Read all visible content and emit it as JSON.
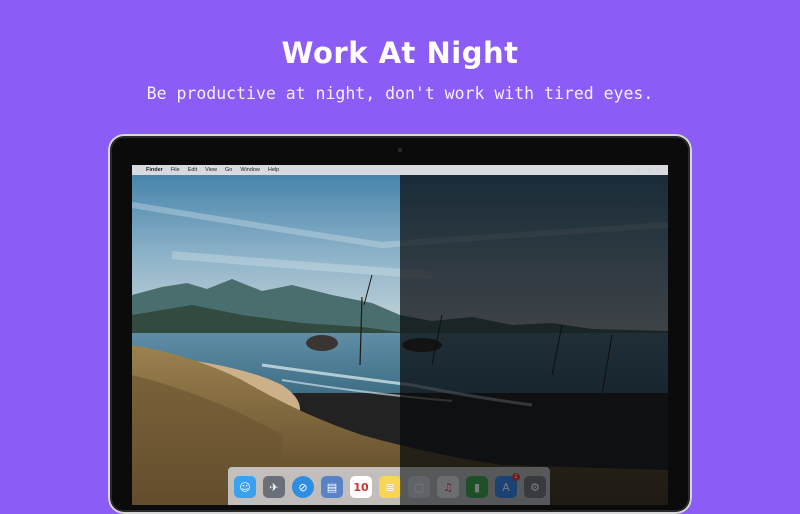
{
  "hero": {
    "title": "Work At Night",
    "subtitle": "Be productive at night, don't work with tired eyes."
  },
  "menubar": {
    "items": [
      "Finder",
      "File",
      "Edit",
      "View",
      "Go",
      "Window",
      "Help"
    ]
  },
  "dock": {
    "calendar_day": "10",
    "app_store_badge": "2"
  },
  "colors": {
    "background": "#8b5cf6",
    "overlay": "#0a0c0e"
  }
}
